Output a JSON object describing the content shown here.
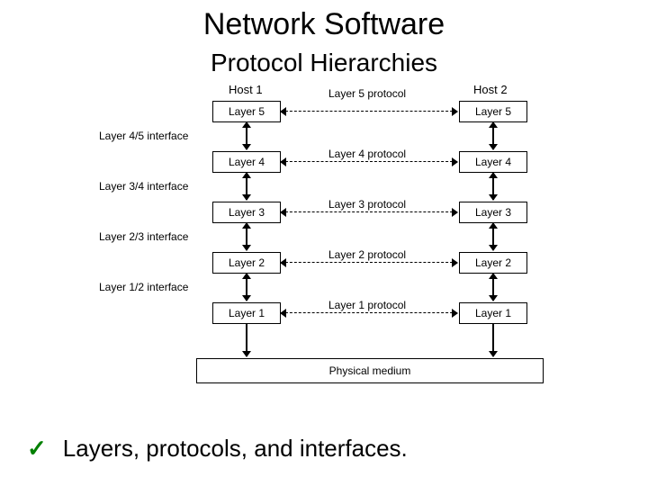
{
  "title": "Network Software",
  "subtitle": "Protocol Hierarchies",
  "hosts": {
    "left": "Host 1",
    "right": "Host 2"
  },
  "layers": {
    "l5": "Layer 5",
    "l4": "Layer 4",
    "l3": "Layer 3",
    "l2": "Layer 2",
    "l1": "Layer 1"
  },
  "protocols": {
    "p5": "Layer 5 protocol",
    "p4": "Layer 4 protocol",
    "p3": "Layer 3 protocol",
    "p2": "Layer 2 protocol",
    "p1": "Layer 1 protocol"
  },
  "interfaces": {
    "i45": "Layer 4/5 interface",
    "i34": "Layer 3/4 interface",
    "i23": "Layer 2/3 interface",
    "i12": "Layer 1/2 interface"
  },
  "medium": "Physical medium",
  "footer": "Layers, protocols, and interfaces."
}
